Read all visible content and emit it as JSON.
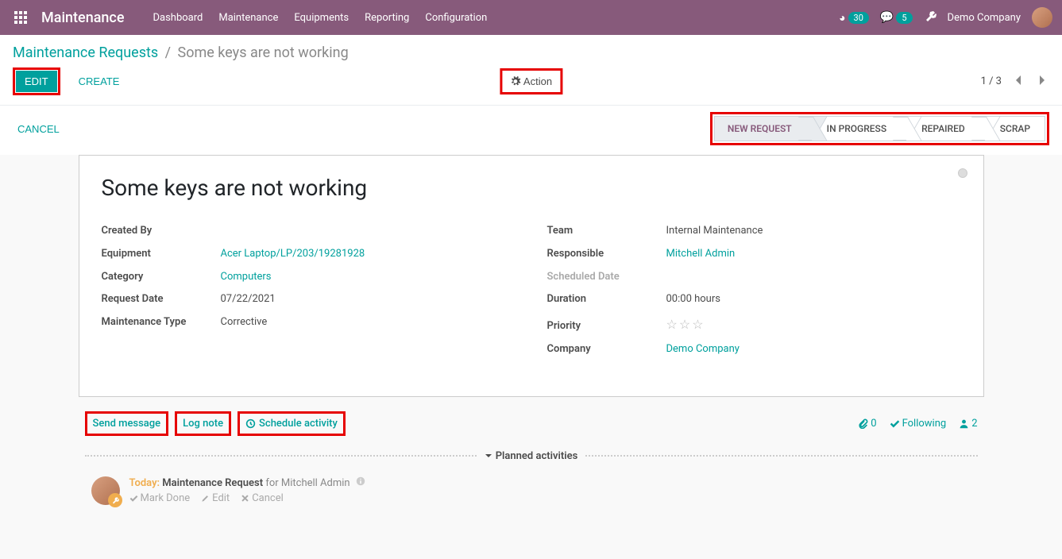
{
  "brand": "Maintenance",
  "nav": {
    "dashboard": "Dashboard",
    "maintenance": "Maintenance",
    "equipments": "Equipments",
    "reporting": "Reporting",
    "configuration": "Configuration"
  },
  "topright": {
    "timer_count": "30",
    "msg_count": "5",
    "company": "Demo Company"
  },
  "breadcrumb": {
    "parent": "Maintenance Requests",
    "current": "Some keys are not working"
  },
  "buttons": {
    "edit": "EDIT",
    "create": "CREATE",
    "action": "Action",
    "cancel": "CANCEL"
  },
  "pager": {
    "text": "1 / 3"
  },
  "status": {
    "s1": "NEW REQUEST",
    "s2": "IN PROGRESS",
    "s3": "REPAIRED",
    "s4": "SCRAP"
  },
  "sheet": {
    "title": "Some keys are not working",
    "labels": {
      "created_by": "Created By",
      "equipment": "Equipment",
      "category": "Category",
      "request_date": "Request Date",
      "maintenance_type": "Maintenance Type",
      "team": "Team",
      "responsible": "Responsible",
      "scheduled_date": "Scheduled Date",
      "duration": "Duration",
      "priority": "Priority",
      "company": "Company"
    },
    "values": {
      "created_by": "",
      "equipment": "Acer Laptop/LP/203/19281928",
      "category": "Computers",
      "request_date": "07/22/2021",
      "maintenance_type": "Corrective",
      "team": "Internal Maintenance",
      "responsible": "Mitchell Admin",
      "scheduled_date": "",
      "duration": "00:00  hours",
      "company": "Demo Company"
    }
  },
  "chatter": {
    "send_message": "Send message",
    "log_note": "Log note",
    "schedule_activity": "Schedule activity",
    "attach_count": "0",
    "following": "Following",
    "followers_count": "2",
    "planned_activities": "Planned activities",
    "activity": {
      "today": "Today:",
      "title": "Maintenance Request",
      "for": "for Mitchell Admin",
      "mark_done": "Mark Done",
      "edit": "Edit",
      "cancel": "Cancel"
    }
  }
}
